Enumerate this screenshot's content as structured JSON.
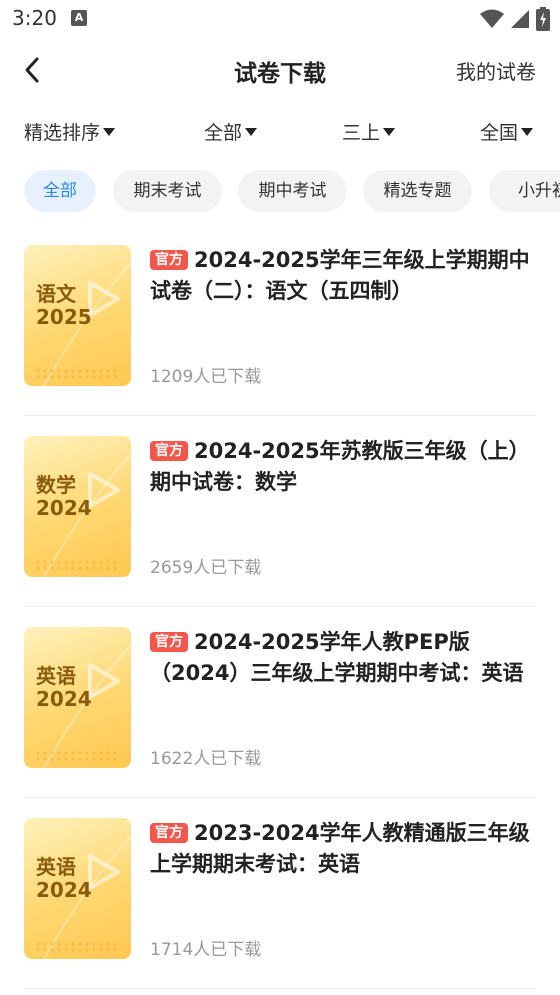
{
  "status_bar": {
    "time": "3:20",
    "notification_icon": "A"
  },
  "header": {
    "title": "试卷下载",
    "right_link": "我的试卷"
  },
  "filters": [
    {
      "label": "精选排序"
    },
    {
      "label": "全部"
    },
    {
      "label": "三上"
    },
    {
      "label": "全国"
    }
  ],
  "chips": [
    {
      "label": "全部",
      "active": true
    },
    {
      "label": "期末考试"
    },
    {
      "label": "期中考试"
    },
    {
      "label": "精选专题"
    },
    {
      "label": "小升初"
    }
  ],
  "items": [
    {
      "cover_subject": "语文",
      "cover_year": "2025",
      "badge": "官方",
      "title": "2024-2025学年三年级上学期期中试卷（二）：语文（五四制）",
      "downloads": "1209人已下载"
    },
    {
      "cover_subject": "数学",
      "cover_year": "2024",
      "badge": "官方",
      "title": "2024-2025年苏教版三年级（上）期中试卷：数学",
      "downloads": "2659人已下载"
    },
    {
      "cover_subject": "英语",
      "cover_year": "2024",
      "badge": "官方",
      "title": "2024-2025学年人教PEP版（2024）三年级上学期期中考试：英语",
      "downloads": "1622人已下载"
    },
    {
      "cover_subject": "英语",
      "cover_year": "2024",
      "badge": "官方",
      "title": "2023-2024学年人教精通版三年级上学期期末考试：英语",
      "downloads": "1714人已下载"
    }
  ],
  "colors": {
    "accent": "#2b87f0",
    "badge": "#f2574b",
    "cover": "#ffd770"
  }
}
